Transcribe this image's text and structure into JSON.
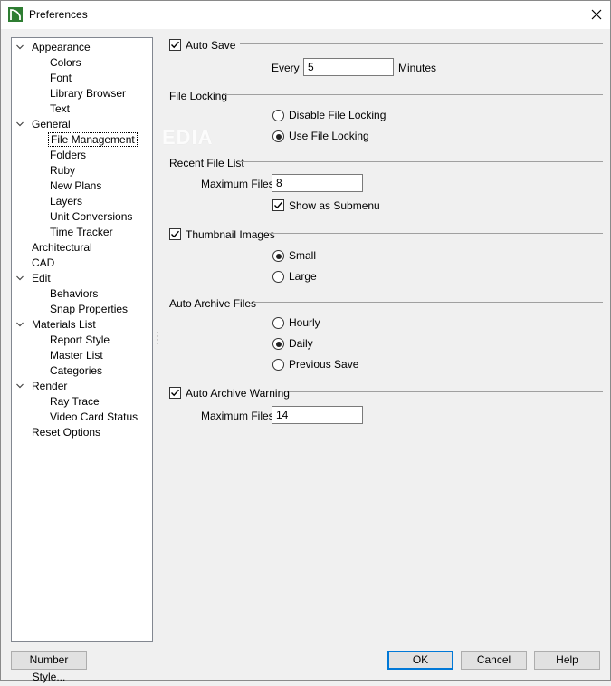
{
  "window": {
    "title": "Preferences"
  },
  "tree": [
    {
      "label": "Appearance",
      "level": 0,
      "expanded": true
    },
    {
      "label": "Colors",
      "level": 1
    },
    {
      "label": "Font",
      "level": 1
    },
    {
      "label": "Library Browser",
      "level": 1
    },
    {
      "label": "Text",
      "level": 1
    },
    {
      "label": "General",
      "level": 0,
      "expanded": true
    },
    {
      "label": "File Management",
      "level": 1,
      "selected": true
    },
    {
      "label": "Folders",
      "level": 1
    },
    {
      "label": "Ruby",
      "level": 1
    },
    {
      "label": "New Plans",
      "level": 1
    },
    {
      "label": "Layers",
      "level": 1
    },
    {
      "label": "Unit Conversions",
      "level": 1
    },
    {
      "label": "Time Tracker",
      "level": 1
    },
    {
      "label": "Architectural",
      "level": 0
    },
    {
      "label": "CAD",
      "level": 0
    },
    {
      "label": "Edit",
      "level": 0,
      "expanded": true
    },
    {
      "label": "Behaviors",
      "level": 1
    },
    {
      "label": "Snap Properties",
      "level": 1
    },
    {
      "label": "Materials List",
      "level": 0,
      "expanded": true
    },
    {
      "label": "Report Style",
      "level": 1
    },
    {
      "label": "Master List",
      "level": 1
    },
    {
      "label": "Categories",
      "level": 1
    },
    {
      "label": "Render",
      "level": 0,
      "expanded": true
    },
    {
      "label": "Ray Trace",
      "level": 1
    },
    {
      "label": "Video Card Status",
      "level": 1
    },
    {
      "label": "Reset Options",
      "level": 0
    }
  ],
  "autosave": {
    "label": "Auto Save",
    "checked": true,
    "every_label": "Every",
    "value": "5",
    "unit": "Minutes"
  },
  "file_locking": {
    "title": "File Locking",
    "disable_label": "Disable File Locking",
    "use_label": "Use File Locking",
    "selected": "use"
  },
  "recent_files": {
    "title": "Recent File List",
    "max_label": "Maximum Files:",
    "max_value": "8",
    "submenu_label": "Show as Submenu",
    "submenu_checked": true
  },
  "thumbnails": {
    "label": "Thumbnail Images",
    "checked": true,
    "small_label": "Small",
    "large_label": "Large",
    "selected": "small"
  },
  "archive": {
    "title": "Auto Archive Files",
    "hourly_label": "Hourly",
    "daily_label": "Daily",
    "previous_label": "Previous Save",
    "selected": "daily",
    "warning_label": "Auto Archive Warning",
    "warning_checked": true,
    "max_label": "Maximum Files:",
    "max_value": "14"
  },
  "watermark": "EDIA",
  "buttons": {
    "number_style": "Number Style...",
    "ok": "OK",
    "cancel": "Cancel",
    "help": "Help"
  }
}
